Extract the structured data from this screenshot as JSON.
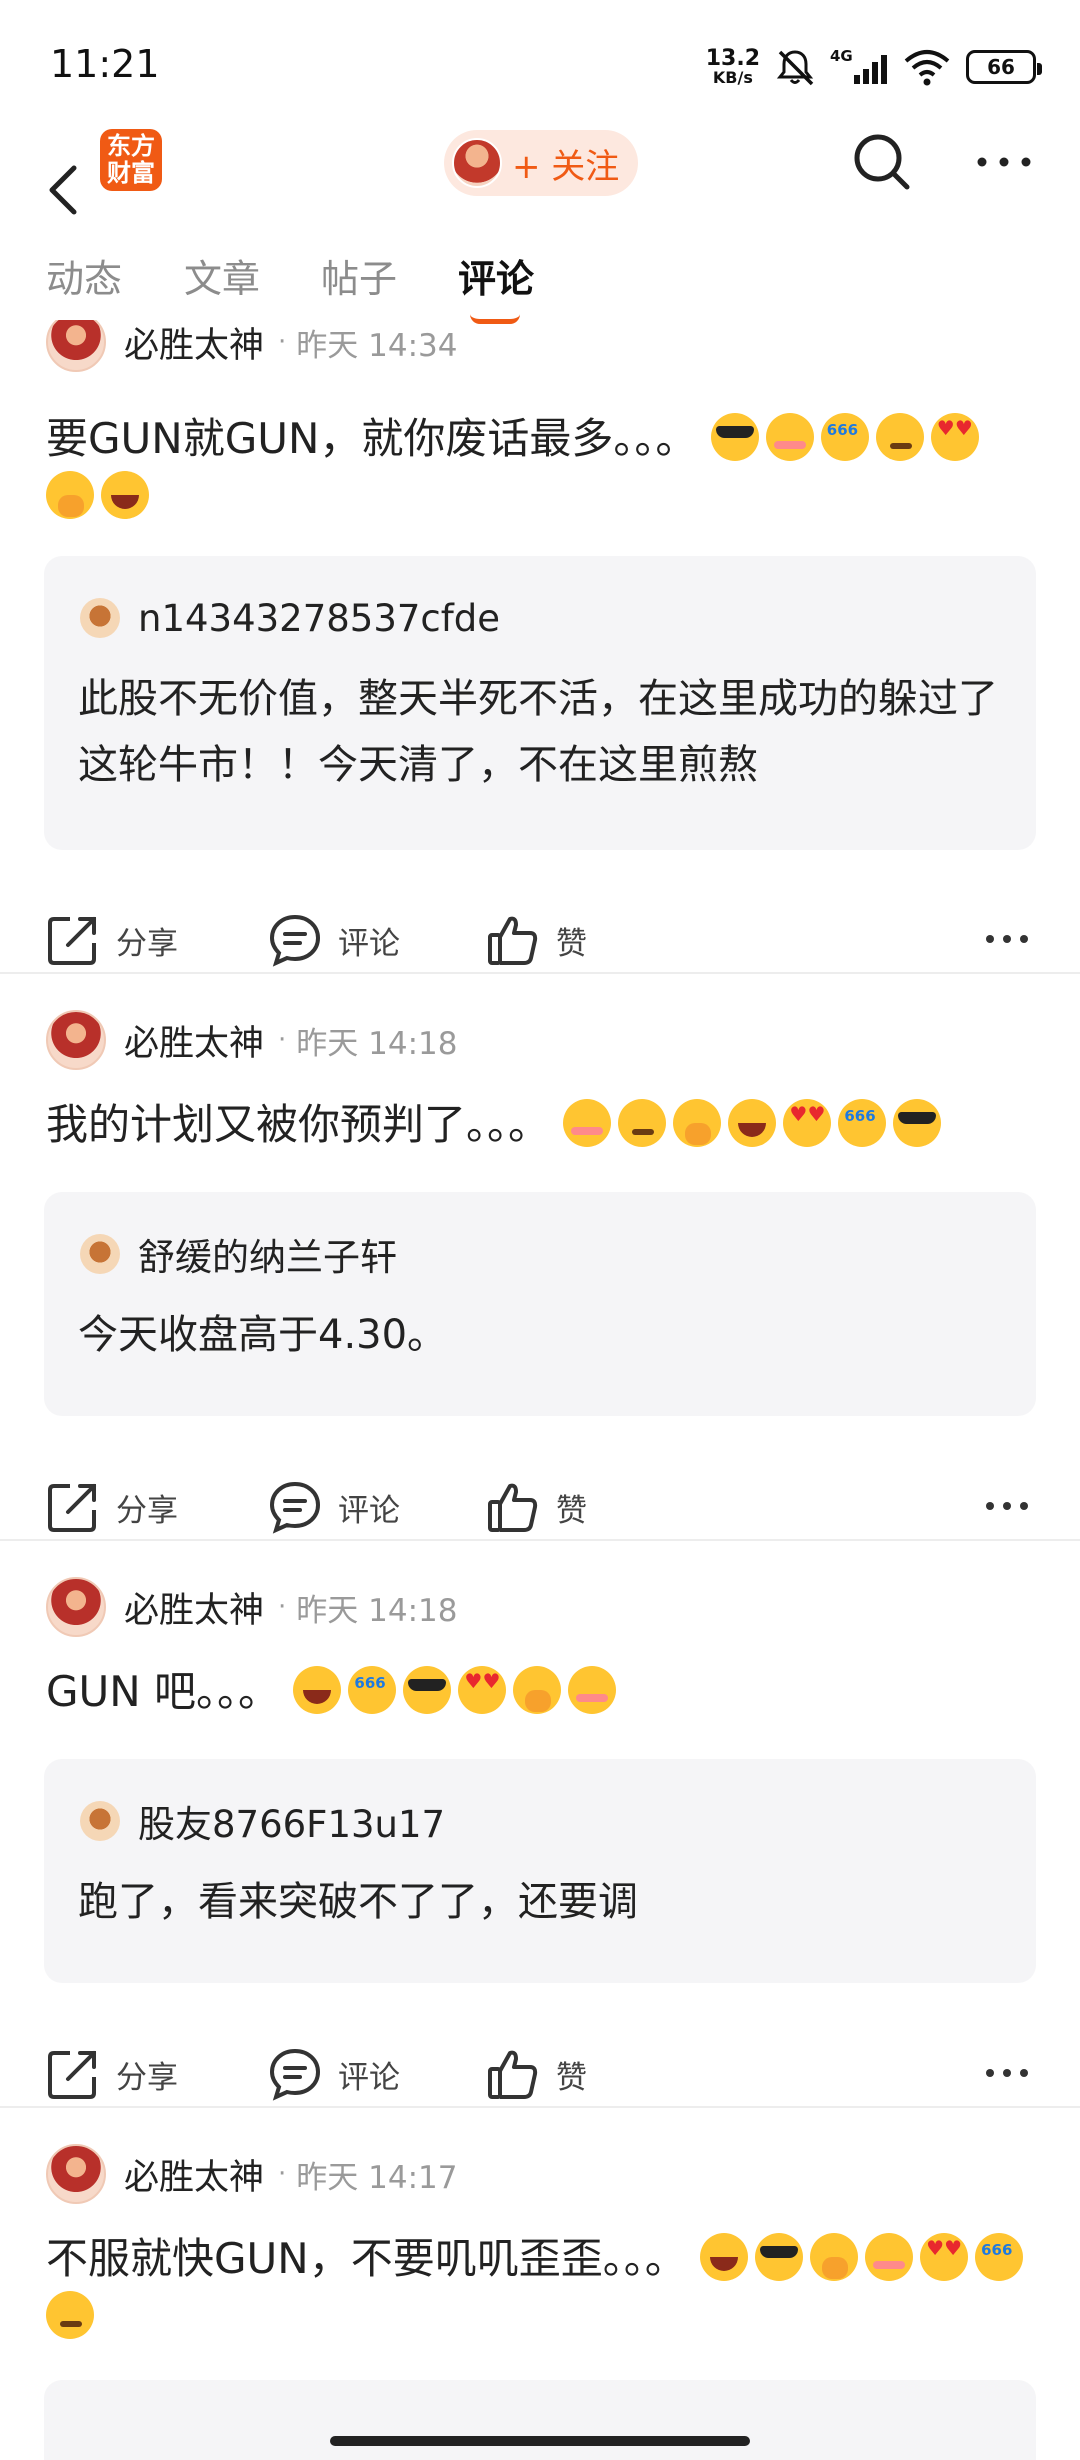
{
  "status_bar": {
    "time": "11:21",
    "net_speed_value": "13.2",
    "net_speed_unit": "KB/s",
    "network": "4G",
    "battery": "66"
  },
  "nav": {
    "logo_line1": "东方",
    "logo_line2": "财富",
    "follow_label": "+ 关注"
  },
  "tabs": [
    {
      "label": "动态",
      "active": false
    },
    {
      "label": "文章",
      "active": false
    },
    {
      "label": "帖子",
      "active": false
    },
    {
      "label": "评论",
      "active": true
    }
  ],
  "actions": {
    "share": "分享",
    "comment": "评论",
    "like": "赞"
  },
  "posts": [
    {
      "author": "必胜太神",
      "time": "昨天 14:34",
      "text": "要GUN就GUN，就你废话最多。。。",
      "emojis": [
        "cool",
        "blush",
        "six",
        "think",
        "heart",
        "hand",
        "grin"
      ],
      "quote": {
        "author": "n14343278537cfde",
        "text": "此股不无价值，整天半死不活，在这里成功的躲过了这轮牛市！！今天清了，不在这里煎熬"
      }
    },
    {
      "author": "必胜太神",
      "time": "昨天 14:18",
      "text": "我的计划又被你预判了。。。",
      "emojis": [
        "blush",
        "think",
        "hand",
        "grin",
        "heart",
        "six",
        "cool"
      ],
      "quote": {
        "author": "舒缓的纳兰子轩",
        "text": "今天收盘高于4.30。"
      }
    },
    {
      "author": "必胜太神",
      "time": "昨天 14:18",
      "text": "GUN 吧。。。",
      "emojis": [
        "grin",
        "six",
        "cool",
        "heart",
        "hand",
        "blush"
      ],
      "quote": {
        "author": "股友8766F13u17",
        "text": "跑了，看来突破不了了，还要调"
      }
    },
    {
      "author": "必胜太神",
      "time": "昨天 14:17",
      "text": "不服就快GUN，不要叽叽歪歪。。。",
      "emojis": [
        "grin",
        "cool",
        "hand",
        "blush",
        "heart",
        "six",
        "think"
      ]
    }
  ]
}
